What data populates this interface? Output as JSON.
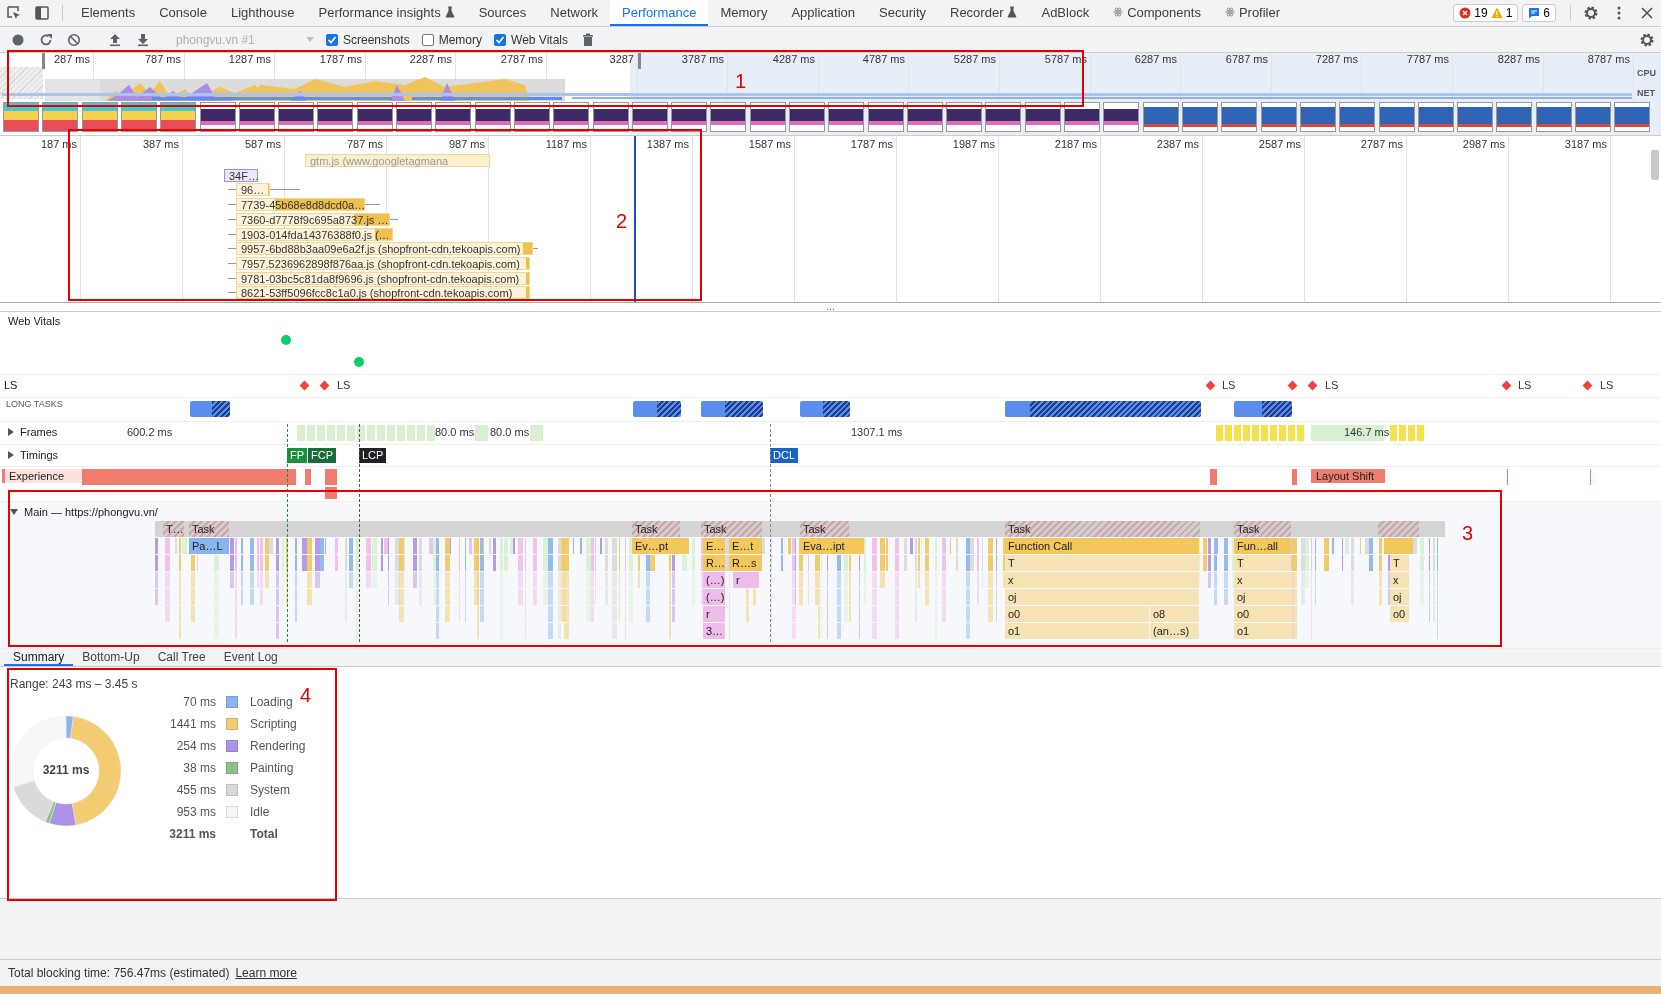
{
  "devtools_tabs": [
    {
      "label": "Elements",
      "selected": false,
      "kind": "plain"
    },
    {
      "label": "Console",
      "selected": false,
      "kind": "plain"
    },
    {
      "label": "Lighthouse",
      "selected": false,
      "kind": "plain"
    },
    {
      "label": "Performance insights",
      "selected": false,
      "kind": "experiment"
    },
    {
      "label": "Sources",
      "selected": false,
      "kind": "plain"
    },
    {
      "label": "Network",
      "selected": false,
      "kind": "plain"
    },
    {
      "label": "Performance",
      "selected": true,
      "kind": "plain"
    },
    {
      "label": "Memory",
      "selected": false,
      "kind": "plain"
    },
    {
      "label": "Application",
      "selected": false,
      "kind": "plain"
    },
    {
      "label": "Security",
      "selected": false,
      "kind": "plain"
    },
    {
      "label": "Recorder",
      "selected": false,
      "kind": "experiment"
    },
    {
      "label": "AdBlock",
      "selected": false,
      "kind": "plain"
    },
    {
      "label": "Components",
      "selected": false,
      "kind": "react"
    },
    {
      "label": "Profiler",
      "selected": false,
      "kind": "react"
    }
  ],
  "issue_counts": {
    "errors": "19",
    "warnings": "1",
    "messages": "6"
  },
  "toolbar": {
    "recording_select": {
      "value": "phongvu.vn #1",
      "disabled": true
    },
    "checkboxes": [
      {
        "label": "Screenshots",
        "checked": true
      },
      {
        "label": "Memory",
        "checked": false
      },
      {
        "label": "Web Vitals",
        "checked": true
      }
    ]
  },
  "overview": {
    "ticks": [
      "287 ms",
      "787 ms",
      "1287 ms",
      "1787 ms",
      "2287 ms",
      "2787 ms",
      "3287",
      "3787 ms",
      "4287 ms",
      "4787 ms",
      "5287 ms",
      "5787 ms",
      "6287 ms",
      "6787 ms",
      "7287 ms",
      "7787 ms",
      "8287 ms",
      "8787 ms"
    ],
    "cpu_label": "CPU",
    "net_label": "NET"
  },
  "timeline": {
    "ticks": [
      "187 ms",
      "387 ms",
      "587 ms",
      "787 ms",
      "987 ms",
      "1187 ms",
      "1387 ms",
      "1587 ms",
      "1787 ms",
      "1987 ms",
      "2187 ms",
      "2387 ms",
      "2587 ms",
      "2787 ms",
      "2987 ms",
      "3187 ms"
    ],
    "requests": [
      {
        "label": "gtm.js (www.googletagmana"
      },
      {
        "label": "34F…"
      },
      {
        "label": "96…"
      },
      {
        "label": "7739-45b68e8d8dcd0a…"
      },
      {
        "label": "7360-d7778f9c695a8737.js …"
      },
      {
        "label": "1903-014fda14376388f0.js (…"
      },
      {
        "label": "9957-6bd88b3aa09e6a2f.js (shopfront-cdn.tekoapis.com)"
      },
      {
        "label": "7957.5236962898f876aa.js (shopfront-cdn.tekoapis.com)"
      },
      {
        "label": "9781-03bc5c81da8f9696.js (shopfront-cdn.tekoapis.com)"
      },
      {
        "label": "8621-53ff5096fcc8c1a0.js (shopfront-cdn.tekoapis.com)"
      }
    ]
  },
  "tracks": {
    "web_vitals": {
      "title": "Web Vitals"
    },
    "layout_shifts": {
      "row_label": "LS",
      "markers": [
        {
          "label": "LS"
        },
        {
          "label": "LS"
        },
        {
          "label": "LS"
        },
        {
          "label": "LS"
        },
        {
          "label": "LS"
        }
      ]
    },
    "long_tasks": {
      "title": "LONG TASKS"
    },
    "frames": {
      "title": "Frames",
      "expanded": false,
      "durations": [
        "600.2 ms",
        "80.0 ms",
        "80.0 ms",
        "1307.1 ms",
        "146.7 ms"
      ]
    },
    "timings": {
      "title": "Timings",
      "expanded": false,
      "marks": [
        {
          "label": "FP",
          "color": "#1e8e3e"
        },
        {
          "label": "FCP",
          "color": "#176d3a"
        },
        {
          "label": "LCP",
          "color": "#202124"
        },
        {
          "label": "DCL",
          "color": "#1a62c6"
        }
      ]
    },
    "experience": {
      "title": "Experience",
      "events": [
        {
          "label": "Layout Shift"
        }
      ]
    },
    "main": {
      "title": "Main — https://phongvu.vn/",
      "expanded": true,
      "entries": [
        {
          "label": "T…",
          "kind": "task"
        },
        {
          "label": "Task",
          "kind": "task",
          "children": [
            {
              "label": "Pa…L",
              "kind": "parse"
            }
          ]
        },
        {
          "label": "Task",
          "kind": "task",
          "children": [
            {
              "label": "Ev…pt",
              "kind": "event"
            }
          ]
        },
        {
          "label": "Task",
          "kind": "task",
          "children": [
            {
              "label": "E…",
              "kind": "event",
              "children": [
                {
                  "label": "R…",
                  "kind": "event",
                  "children": [
                    {
                      "label": "(…)",
                      "kind": "function",
                      "children": [
                        {
                          "label": "(…)",
                          "kind": "function",
                          "children": [
                            {
                              "label": "r",
                              "kind": "function",
                              "children": [
                                {
                                  "label": "3…",
                                  "kind": "function"
                                }
                              ]
                            }
                          ]
                        }
                      ]
                    }
                  ]
                }
              ]
            },
            {
              "label": "E…t",
              "kind": "event",
              "children": [
                {
                  "label": "R…s",
                  "kind": "event",
                  "children": [
                    {
                      "label": "r",
                      "kind": "function"
                    }
                  ]
                }
              ]
            }
          ]
        },
        {
          "label": "Task",
          "kind": "task",
          "children": [
            {
              "label": "Eva…ipt",
              "kind": "event"
            }
          ]
        },
        {
          "label": "Task",
          "kind": "task",
          "children": [
            {
              "label": "Function Call",
              "kind": "event",
              "children": [
                {
                  "label": "T",
                  "kind": "call",
                  "children": [
                    {
                      "label": "x",
                      "kind": "call",
                      "children": [
                        {
                          "label": "oj",
                          "kind": "call",
                          "children": [
                            {
                              "label": "o0",
                              "kind": "call",
                              "children": [
                                {
                                  "label": "o1",
                                  "kind": "call"
                                }
                              ]
                            },
                            {
                              "label": "o8",
                              "kind": "call",
                              "children": [
                                {
                                  "label": "(an…s)",
                                  "kind": "call"
                                }
                              ]
                            }
                          ]
                        }
                      ]
                    }
                  ]
                }
              ]
            }
          ]
        },
        {
          "label": "Task",
          "kind": "task",
          "children": [
            {
              "label": "Fun…all",
              "kind": "event",
              "children": [
                {
                  "label": "T",
                  "kind": "call",
                  "children": [
                    {
                      "label": "x",
                      "kind": "call",
                      "children": [
                        {
                          "label": "oj",
                          "kind": "call",
                          "children": [
                            {
                              "label": "o0",
                              "kind": "call",
                              "children": [
                                {
                                  "label": "o1",
                                  "kind": "call"
                                }
                              ]
                            }
                          ]
                        }
                      ]
                    }
                  ]
                }
              ]
            }
          ]
        },
        {
          "kind": "task",
          "children": [
            {
              "kind": "event",
              "children": [
                {
                  "label": "T",
                  "kind": "call",
                  "children": [
                    {
                      "label": "x",
                      "kind": "call",
                      "children": [
                        {
                          "label": "oj",
                          "kind": "call",
                          "children": [
                            {
                              "label": "o0",
                              "kind": "call"
                            }
                          ]
                        }
                      ]
                    }
                  ]
                }
              ]
            }
          ]
        }
      ]
    }
  },
  "summary_tabs": [
    {
      "label": "Summary",
      "selected": true
    },
    {
      "label": "Bottom-Up",
      "selected": false
    },
    {
      "label": "Call Tree",
      "selected": false
    },
    {
      "label": "Event Log",
      "selected": false
    }
  ],
  "summary": {
    "range": "Range: 243 ms – 3.45 s",
    "center_total": "3211 ms",
    "categories": [
      {
        "value": "70 ms",
        "color": "#8ab4f0"
      },
      {
        "value": "1441 ms",
        "color": "#f2cb72"
      },
      {
        "value": "254 ms",
        "color": "#ae92e8"
      },
      {
        "value": "38 ms",
        "color": "#8fc08a"
      },
      {
        "value": "455 ms",
        "color": "#dadada"
      },
      {
        "value": "953 ms",
        "color": "#f7f7f7"
      }
    ],
    "total": {
      "value": "3211 ms",
      "label": "Total"
    },
    "chart_data": {
      "type": "donut",
      "categories": [
        "Loading",
        "Scripting",
        "Rendering",
        "Painting",
        "System",
        "Idle"
      ],
      "values": [
        2.18,
        44.88,
        7.91,
        1.18,
        14.17,
        29.68
      ]
    }
  },
  "resize_handle": "...",
  "footer": {
    "text": "Total blocking time: 756.47ms (estimated)",
    "link": "Learn more"
  },
  "annotations": [
    {
      "label": "1"
    },
    {
      "label": "2"
    },
    {
      "label": "3"
    },
    {
      "label": "4"
    }
  ]
}
